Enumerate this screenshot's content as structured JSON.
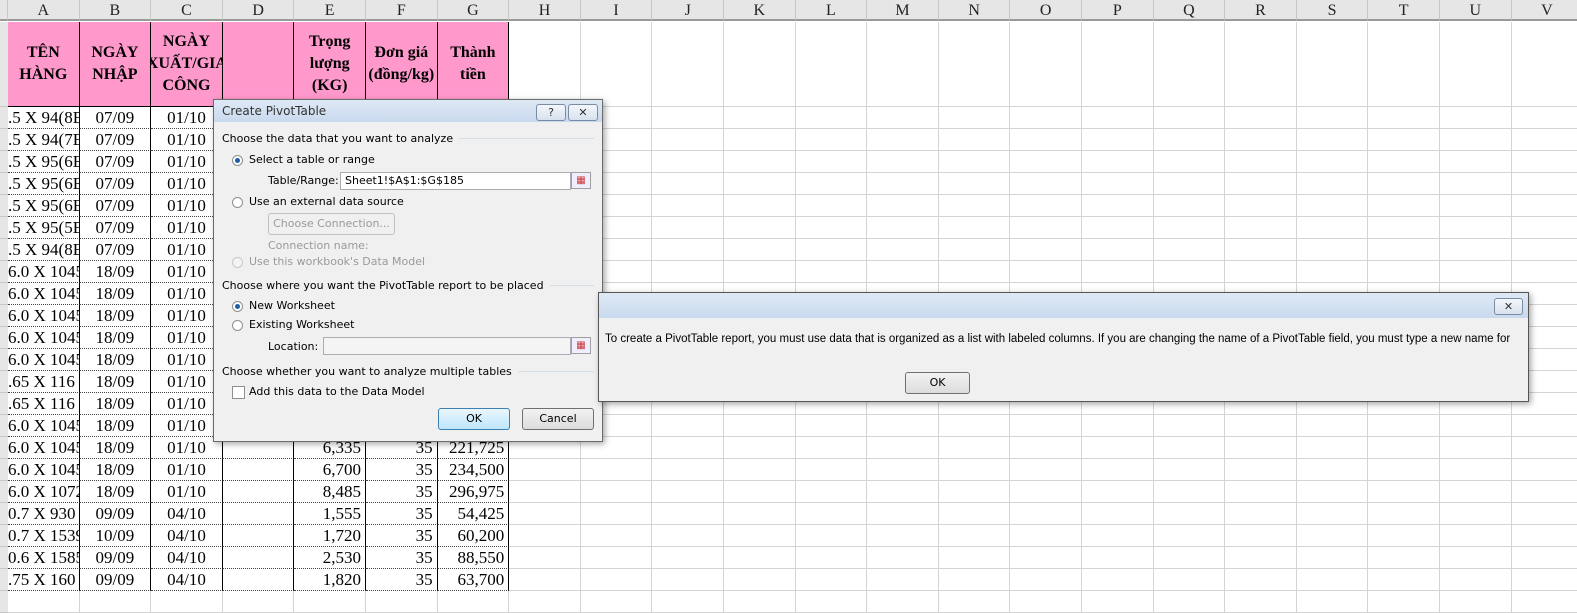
{
  "columns": [
    "A",
    "B",
    "C",
    "D",
    "E",
    "F",
    "G",
    "H",
    "I",
    "J",
    "K",
    "L",
    "M",
    "N",
    "O",
    "P",
    "Q",
    "R",
    "S",
    "T",
    "U",
    "V"
  ],
  "headers": [
    "TÊN HÀNG",
    "NGÀY NHẬP",
    "NGÀY XUẤT/GIA CÔNG",
    "",
    "Trọng lượng (KG)",
    "Đơn giá (đồng/kg)",
    "Thành tiền"
  ],
  "rows": [
    [
      ".5 X 94(8E",
      "07/09",
      "01/10",
      "",
      "",
      "",
      ""
    ],
    [
      ".5 X 94(7E",
      "07/09",
      "01/10",
      "",
      "",
      "",
      ""
    ],
    [
      ".5 X 95(6E",
      "07/09",
      "01/10",
      "",
      "",
      "",
      ""
    ],
    [
      ".5 X 95(6E",
      "07/09",
      "01/10",
      "",
      "",
      "",
      ""
    ],
    [
      ".5 X 95(6E",
      "07/09",
      "01/10",
      "",
      "",
      "",
      ""
    ],
    [
      ".5 X 95(5E",
      "07/09",
      "01/10",
      "",
      "",
      "",
      ""
    ],
    [
      ".5 X 94(8E",
      "07/09",
      "01/10",
      "",
      "",
      "",
      ""
    ],
    [
      "6.0 X 1045",
      "18/09",
      "01/10",
      "",
      "",
      "",
      ""
    ],
    [
      "6.0 X 1045",
      "18/09",
      "01/10",
      "",
      "",
      "",
      ""
    ],
    [
      "6.0 X 1045",
      "18/09",
      "01/10",
      "",
      "",
      "",
      ""
    ],
    [
      "6.0 X 1045",
      "18/09",
      "01/10",
      "",
      "",
      "",
      ""
    ],
    [
      "6.0 X 1045",
      "18/09",
      "01/10",
      "",
      "",
      "",
      ""
    ],
    [
      ".65 X 116",
      "18/09",
      "01/10",
      "",
      "",
      "",
      ""
    ],
    [
      ".65 X 116",
      "18/09",
      "01/10",
      "",
      "",
      "",
      ""
    ],
    [
      "6.0 X 1045",
      "18/09",
      "01/10",
      "",
      "",
      "",
      ""
    ],
    [
      "6.0 X 1045",
      "18/09",
      "01/10",
      "",
      "6,335",
      "35",
      "221,725"
    ],
    [
      "6.0 X 1045",
      "18/09",
      "01/10",
      "",
      "6,700",
      "35",
      "234,500"
    ],
    [
      "6.0 X 1072",
      "18/09",
      "01/10",
      "",
      "8,485",
      "35",
      "296,975"
    ],
    [
      "0.7 X 930",
      "09/09",
      "04/10",
      "",
      "1,555",
      "35",
      "54,425"
    ],
    [
      "0.7 X 1539",
      "10/09",
      "04/10",
      "",
      "1,720",
      "35",
      "60,200"
    ],
    [
      "0.6 X 1585",
      "09/09",
      "04/10",
      "",
      "2,530",
      "35",
      "88,550"
    ],
    [
      ".75 X 160",
      "09/09",
      "04/10",
      "",
      "1,820",
      "35",
      "63,700"
    ]
  ],
  "pivot_dialog": {
    "title": "Create PivotTable",
    "help": "?",
    "close": "✕",
    "section1": "Choose the data that you want to analyze",
    "select_range": "Select a table or range",
    "table_range_label": "Table/Range:",
    "table_range_value": "Sheet1!$A$1:$G$185",
    "external": "Use an external data source",
    "choose_connection": "Choose Connection...",
    "connection_name": "Connection name:",
    "data_model_source": "Use this workbook's Data Model",
    "section2": "Choose where you want the PivotTable report to be placed",
    "new_ws": "New Worksheet",
    "existing_ws": "Existing Worksheet",
    "location_label": "Location:",
    "location_value": "",
    "section3": "Choose whether you want to analyze multiple tables",
    "add_model": "Add this data to the Data Model",
    "ok": "OK",
    "cancel": "Cancel"
  },
  "error_dialog": {
    "close": "✕",
    "message": "To create a PivotTable report, you must use data that is organized as a list with labeled columns. If you are changing the name of a PivotTable field, you must type a new name for",
    "ok": "OK"
  }
}
